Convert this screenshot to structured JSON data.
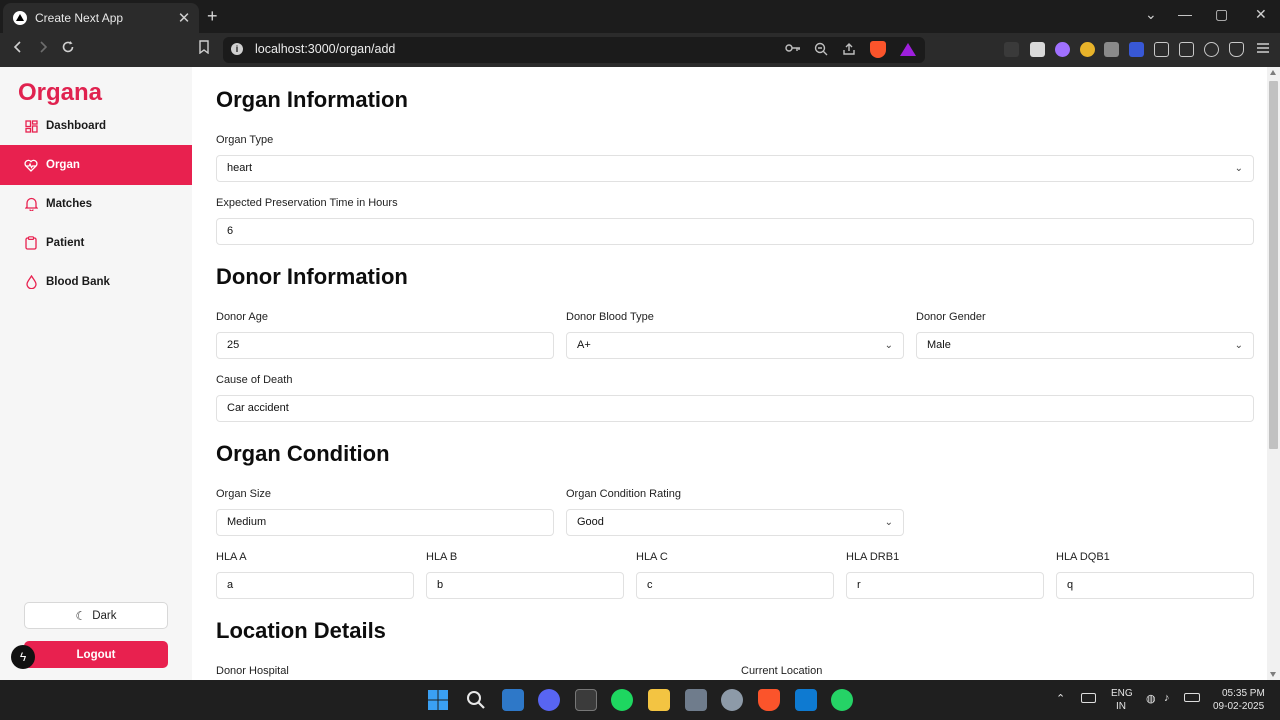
{
  "browser": {
    "tab_title": "Create Next App",
    "tab_close": "✕",
    "new_tab": "+",
    "url": "localhost:3000/organ/add",
    "window_controls": {
      "dropdown": "⌄",
      "minimize": "—",
      "maximize": "▢",
      "close": "✕"
    }
  },
  "sidebar": {
    "brand": "Organa",
    "items": [
      {
        "label": "Dashboard",
        "icon": "dashboard-icon"
      },
      {
        "label": "Organ",
        "icon": "heart-pulse-icon"
      },
      {
        "label": "Matches",
        "icon": "bell-icon"
      },
      {
        "label": "Patient",
        "icon": "clipboard-icon"
      },
      {
        "label": "Blood Bank",
        "icon": "droplet-icon"
      }
    ],
    "active_item": "Organ",
    "dark_label": "Dark",
    "logout_label": "Logout"
  },
  "form": {
    "organ_info": {
      "heading": "Organ Information",
      "organ_type_label": "Organ Type",
      "organ_type_value": "heart",
      "preservation_label": "Expected Preservation Time in Hours",
      "preservation_value": "6"
    },
    "donor_info": {
      "heading": "Donor Information",
      "age_label": "Donor Age",
      "age_value": "25",
      "blood_type_label": "Donor Blood Type",
      "blood_type_value": "A+",
      "gender_label": "Donor Gender",
      "gender_value": "Male",
      "cause_label": "Cause of Death",
      "cause_value": "Car accident"
    },
    "organ_condition": {
      "heading": "Organ Condition",
      "size_label": "Organ Size",
      "size_value": "Medium",
      "rating_label": "Organ Condition Rating",
      "rating_value": "Good",
      "hla": [
        {
          "label": "HLA A",
          "value": "a"
        },
        {
          "label": "HLA B",
          "value": "b"
        },
        {
          "label": "HLA C",
          "value": "c"
        },
        {
          "label": "HLA DRB1",
          "value": "r"
        },
        {
          "label": "HLA DQB1",
          "value": "q"
        }
      ]
    },
    "location": {
      "heading": "Location Details",
      "donor_hospital_label": "Donor Hospital",
      "current_location_label": "Current Location"
    }
  },
  "taskbar": {
    "lang_top": "ENG",
    "lang_bottom": "IN",
    "time": "05:35 PM",
    "date": "09-02-2025"
  },
  "colors": {
    "brand": "#e0224f",
    "accent": "#e8214f",
    "page_bg": "#ffffff",
    "sidebar_bg": "#f6f6f6"
  }
}
